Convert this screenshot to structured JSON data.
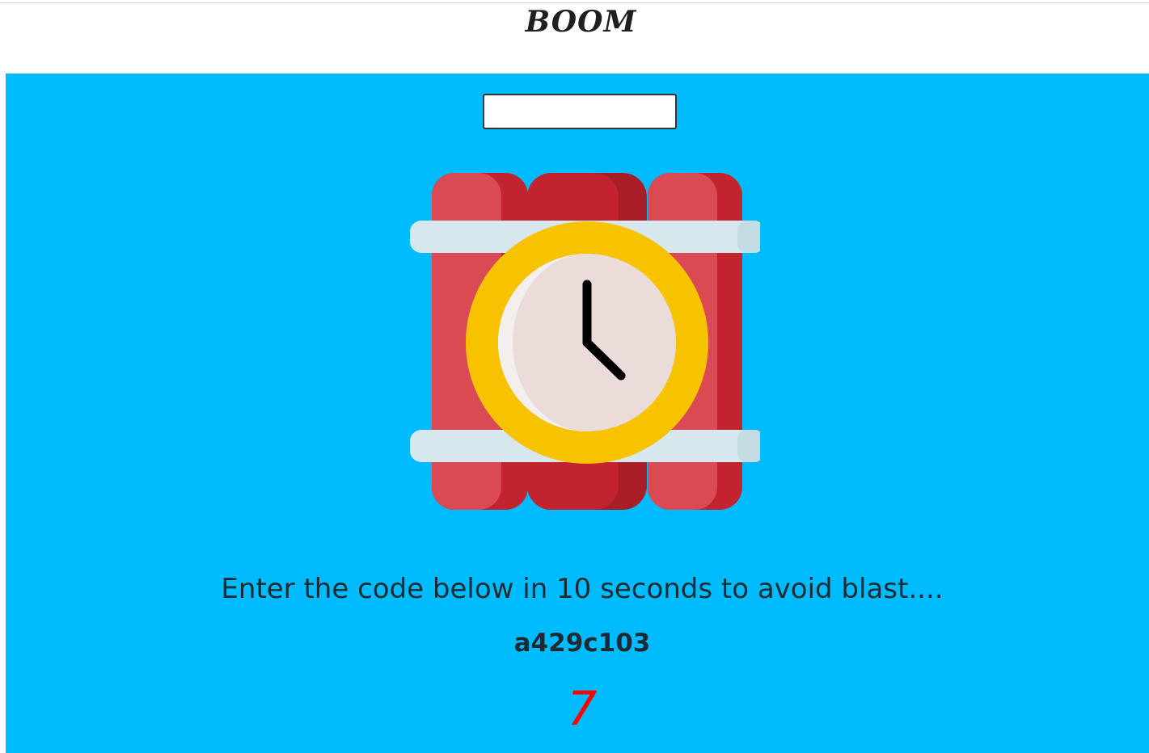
{
  "header": {
    "title": "BOOM"
  },
  "game": {
    "code_input_value": "",
    "bomb_icon": "dynamite-timer-icon",
    "instruction": "Enter the code below in 10 seconds to avoid blast....",
    "code": "a429c103",
    "countdown": "7"
  },
  "colors": {
    "panel_background": "#00bbfd",
    "countdown": "#ff0000",
    "dynamite_red": "#c3232f",
    "clock_ring": "#f7c300"
  }
}
